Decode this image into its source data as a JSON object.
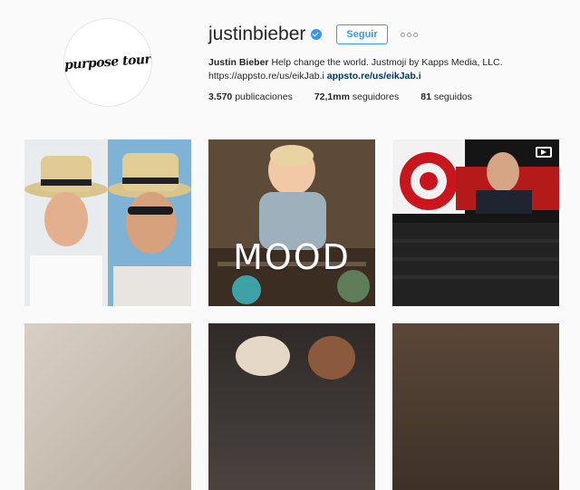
{
  "profile": {
    "avatar_text": "purpose tour",
    "username": "justinbieber",
    "follow_label": "Seguir",
    "bio_name": "Justin Bieber",
    "bio_text": " Help change the world. Justmoji by Kapps Media, LLC. https://appsto.re/us/eikJab.i ",
    "bio_link": "appsto.re/us/eikJab.i",
    "stats": {
      "posts_num": "3.570",
      "posts_label": " publicaciones",
      "followers_num": "72,1mm",
      "followers_label": " seguidores",
      "following_num": "81",
      "following_label": " seguidos"
    }
  },
  "grid": {
    "tile2_caption": "MOOD"
  },
  "colors": {
    "accent": "#3897f0",
    "link": "#003569",
    "background": "#fafafa"
  },
  "icons": [
    "verified-badge-icon",
    "more-options-icon",
    "video-icon"
  ]
}
